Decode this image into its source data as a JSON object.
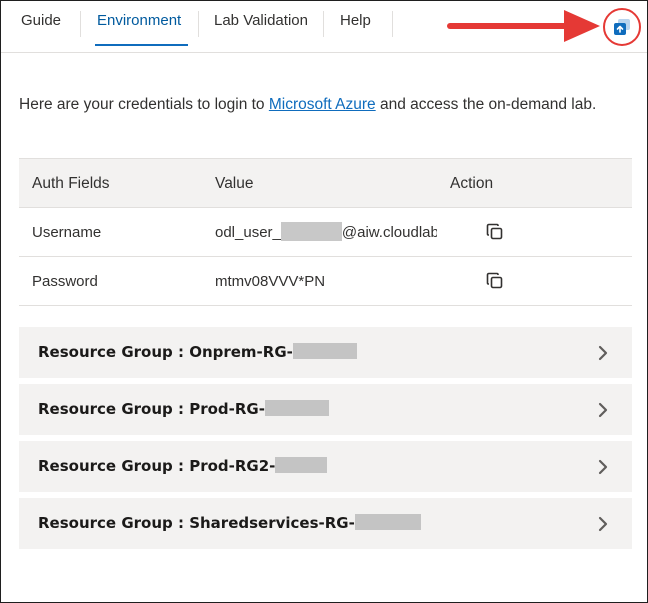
{
  "tabs": [
    {
      "label": "Guide",
      "active": false
    },
    {
      "label": "Environment",
      "active": true
    },
    {
      "label": "Lab Validation",
      "active": false
    },
    {
      "label": "Help",
      "active": false
    }
  ],
  "intro": {
    "before": "Here are your credentials to login to ",
    "link": "Microsoft Azure",
    "after": " and access the on-demand lab."
  },
  "table": {
    "headers": [
      "Auth Fields",
      "Value",
      "Action"
    ],
    "rows": [
      {
        "field": "Username",
        "value_prefix": "odl_user_",
        "value_suffix": "@aiw.cloudlabs.ai"
      },
      {
        "field": "Password",
        "value": "mtmv08VVV*PN"
      }
    ]
  },
  "resource_groups": [
    "Resource Group : Onprem-RG-",
    "Resource Group : Prod-RG-",
    "Resource Group : Prod-RG2-",
    "Resource Group : Sharedservices-RG-"
  ],
  "colors": {
    "accent": "#0f6cbd",
    "annotation": "#e53935",
    "panel": "#f3f2f1"
  },
  "icons": [
    "popout-icon",
    "copy-icon",
    "chevron-right-icon",
    "red-arrow"
  ]
}
